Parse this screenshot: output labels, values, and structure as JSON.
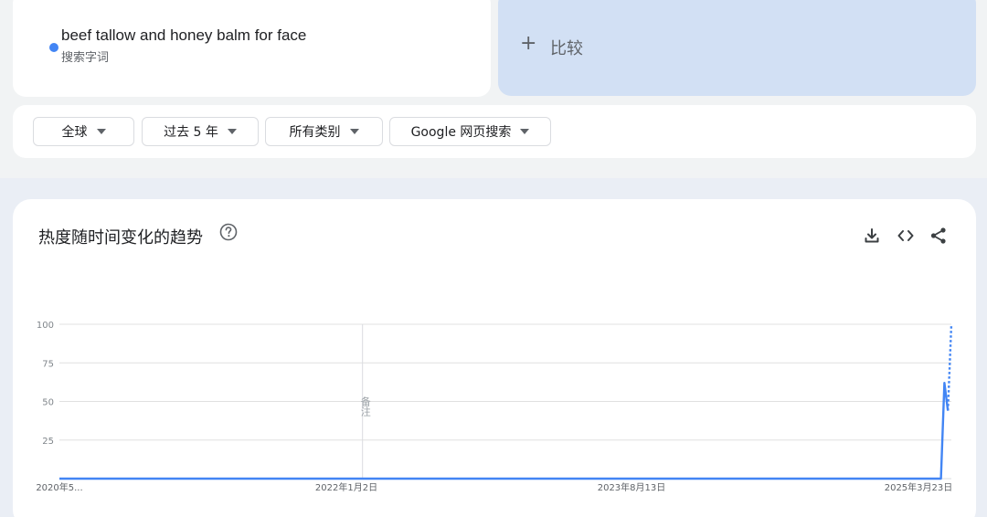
{
  "search_term": {
    "name": "beef tallow and honey balm for face",
    "type_label": "搜索字词",
    "color": "#4285f4"
  },
  "compare": {
    "plus": "+",
    "label": "比较"
  },
  "filters": [
    {
      "label": "全球"
    },
    {
      "label": "过去 5 年"
    },
    {
      "label": "所有类别"
    },
    {
      "label": "Google 网页搜索"
    }
  ],
  "interest_card": {
    "title": "热度随时间变化的趋势",
    "actions": [
      "download-icon",
      "embed-code-icon",
      "share-icon"
    ]
  },
  "chart_data": {
    "type": "line",
    "ylim": [
      0,
      100
    ],
    "yticks": [
      100,
      75,
      50,
      25
    ],
    "x_tick_labels": [
      "2020年5...",
      "2022年1月2日",
      "2023年8月13日",
      "2025年3月23日"
    ],
    "note_label": "备注",
    "series": [
      {
        "color": "#4285f4",
        "points": [
          {
            "x": "2020-05",
            "y": 0
          },
          {
            "x": "2022-01-02",
            "y": 0
          },
          {
            "x": "2023-08-13",
            "y": 0
          },
          {
            "x": "2025-03-09",
            "y": 0
          },
          {
            "x": "2025-03-16",
            "y": 62
          },
          {
            "x": "2025-03-23",
            "y": 44
          }
        ],
        "partial_points": [
          {
            "x": "2025-03-23",
            "y": 44
          },
          {
            "x": "2025-03-30",
            "y": 100
          }
        ]
      }
    ]
  }
}
